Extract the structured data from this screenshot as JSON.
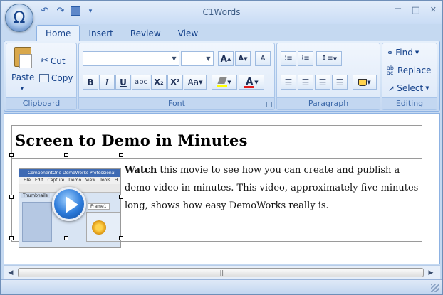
{
  "window": {
    "title": "C1Words"
  },
  "app_menu": {
    "glyph": "Ω"
  },
  "quick_access": {
    "undo": "↶",
    "redo": "↷",
    "save": "💾",
    "customize": "▾"
  },
  "window_controls": {
    "minimize": "—",
    "maximize": "□",
    "close": "✕"
  },
  "tabs": [
    "Home",
    "Insert",
    "Review",
    "View"
  ],
  "ribbon": {
    "clipboard": {
      "label": "Clipboard",
      "paste": "Paste",
      "cut": "Cut",
      "copy": "Copy"
    },
    "font": {
      "label": "Font",
      "family_value": "",
      "size_value": "",
      "grow": "A",
      "shrink": "A",
      "clear": "A",
      "bold": "B",
      "italic": "I",
      "underline": "U",
      "strike": "abc",
      "subscript": "X₂",
      "superscript": "X²",
      "change_case": "Aa",
      "highlight_color": "#ffff00",
      "font_color": "#e01b1b"
    },
    "paragraph": {
      "label": "Paragraph"
    },
    "editing": {
      "label": "Editing",
      "find": "Find",
      "replace": "Replace",
      "select": "Select"
    }
  },
  "document": {
    "heading": "Screen to Demo in Minutes",
    "body_lead": "Watch",
    "body_rest": " this movie to see how you can create and publish a demo video in minutes. This video, approximately five minutes long, shows how easy DemoWorks really is.",
    "thumbnail": {
      "title": "ComponentOne DemoWorks Professional",
      "menu": [
        "File",
        "Edit",
        "Capture",
        "Demo",
        "View",
        "Tools",
        "H"
      ],
      "panel": "Thumbnails",
      "tab": "Frame1"
    }
  },
  "scrollbar": {
    "grip": "|||",
    "left": "◀",
    "right": "▶"
  }
}
